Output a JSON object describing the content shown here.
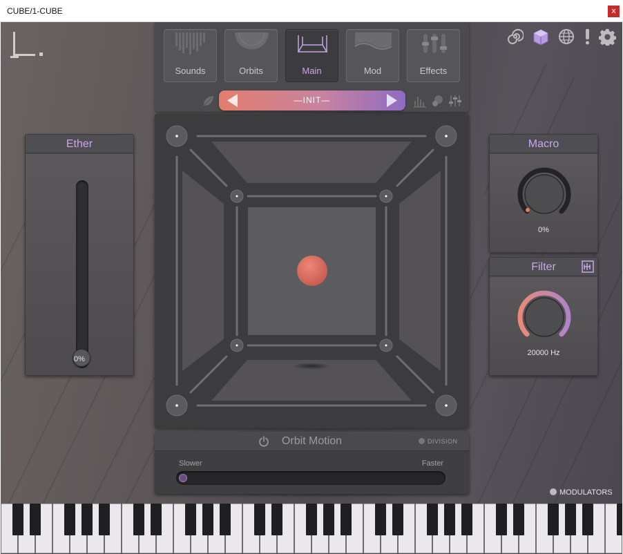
{
  "window": {
    "title": "CUBE/1-CUBE",
    "close_label": "x"
  },
  "nav": {
    "tabs": [
      {
        "label": "Sounds",
        "icon": "sounds-icon",
        "active": false
      },
      {
        "label": "Orbits",
        "icon": "orbits-icon",
        "active": false
      },
      {
        "label": "Main",
        "icon": "main-cube-icon",
        "active": true
      },
      {
        "label": "Mod",
        "icon": "mod-icon",
        "active": false
      },
      {
        "label": "Effects",
        "icon": "effects-icon",
        "active": false
      }
    ],
    "preset_name": "—INIT—"
  },
  "ether": {
    "title": "Ether",
    "value": "0%",
    "level": 0
  },
  "macro": {
    "title": "Macro",
    "value": "0%",
    "level": 0
  },
  "filter": {
    "title": "Filter",
    "value": "20000 Hz",
    "level": 1
  },
  "orbit_motion": {
    "title": "Orbit Motion",
    "division_label": "DIVISION",
    "slower_label": "Slower",
    "faster_label": "Faster",
    "speed": 0
  },
  "modulators_label": "MODULATORS",
  "top_icons": [
    "spiral-icon",
    "cube-icon",
    "globe-icon",
    "alert-icon",
    "gear-icon"
  ],
  "colors": {
    "accent_purple": "#c9a7e9",
    "preset_gradient_start": "#e27d6d",
    "preset_gradient_end": "#8e6bc2",
    "orb": "#d9685c"
  }
}
